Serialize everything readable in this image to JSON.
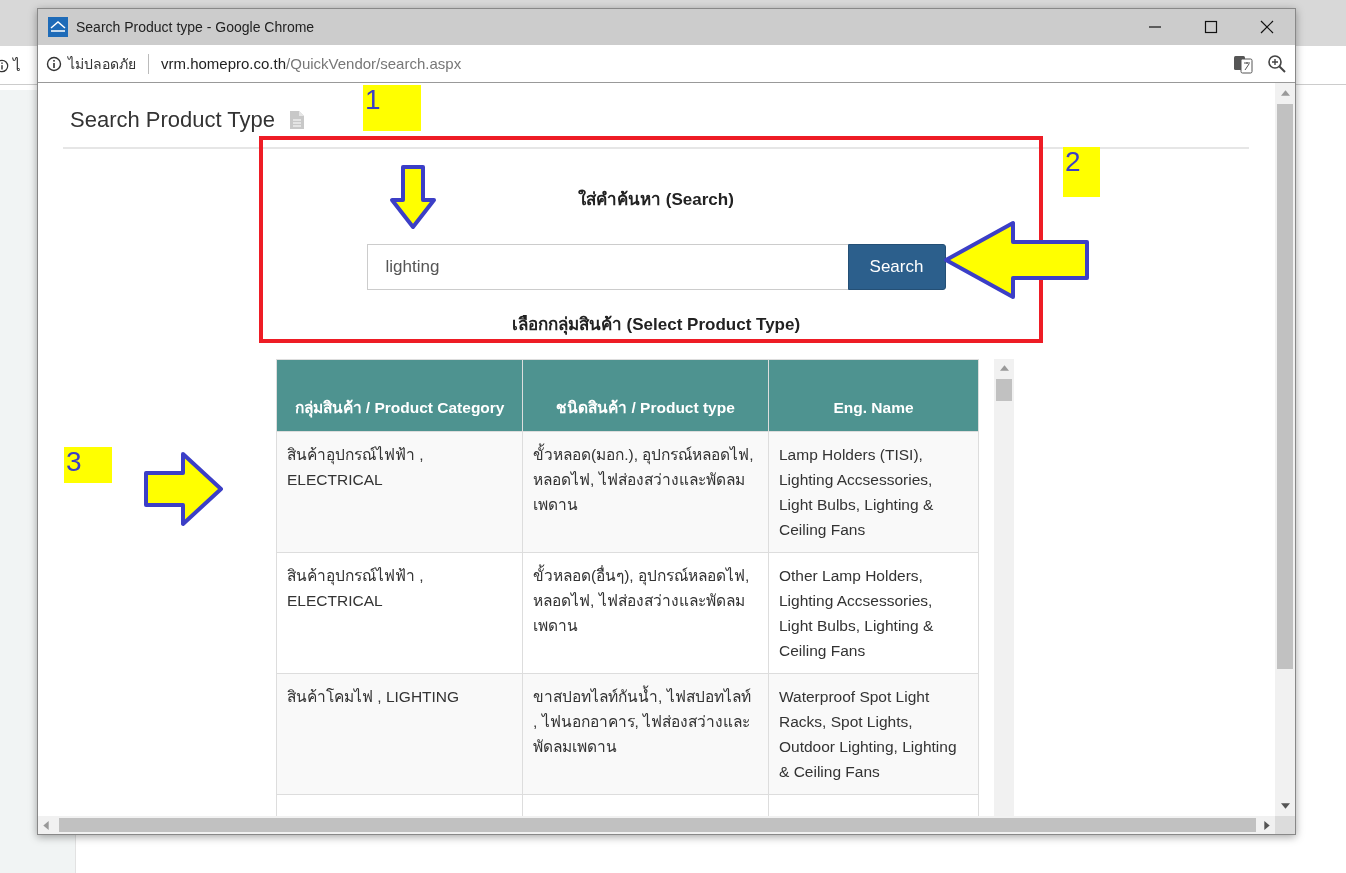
{
  "background": {
    "address_fragment": "ไ"
  },
  "window": {
    "title": "Search Product type - Google Chrome"
  },
  "address_bar": {
    "security": "ไม่ปลอดภัย",
    "url_host": "vrm.homepro.co.th",
    "url_path": "/QuickVendor/search.aspx"
  },
  "page": {
    "heading": "Search Product Type",
    "search_label": "ใส่คำค้นหา (Search)",
    "search_field": {
      "value": "lighting"
    },
    "search_button": "Search",
    "select_label": "เลือกกลุ่มสินค้า (Select Product Type)"
  },
  "table": {
    "columns": [
      "กลุ่มสินค้า / Product Category",
      "ชนิดสินค้า / Product type",
      "Eng. Name"
    ],
    "rows": [
      {
        "cells": [
          "สินค้าอุปกรณ์ไฟฟ้า , ELECTRICAL",
          "ขั้วหลอด(มอก.), อุปกรณ์หลอดไฟ, หลอดไฟ, ไฟส่องสว่างและพัดลมเพดาน",
          "Lamp Holders (TISI), Lighting Accsessories, Light Bulbs, Lighting & Ceiling Fans"
        ]
      },
      {
        "cells": [
          "สินค้าอุปกรณ์ไฟฟ้า , ELECTRICAL",
          "ขั้วหลอด(อื่นๆ), อุปกรณ์หลอดไฟ, หลอดไฟ, ไฟส่องสว่างและพัดลมเพดาน",
          "Other Lamp Holders, Lighting Accsessories, Light Bulbs, Lighting & Ceiling Fans"
        ]
      },
      {
        "cells": [
          "สินค้าโคมไฟ , LIGHTING",
          "ขาสปอทไลท์กันน้ำ, ไฟสปอทไลท์ , ไฟนอกอาคาร, ไฟส่องสว่างและพัดลมเพดาน",
          "Waterproof Spot Light Racks, Spot Lights, Outdoor Lighting, Lighting & Ceiling Fans"
        ]
      }
    ]
  },
  "annotations": {
    "markers": [
      {
        "label": "1"
      },
      {
        "label": "2"
      },
      {
        "label": "3"
      }
    ],
    "arrows": [
      {
        "kind": "down"
      },
      {
        "kind": "left"
      },
      {
        "kind": "right"
      }
    ]
  }
}
